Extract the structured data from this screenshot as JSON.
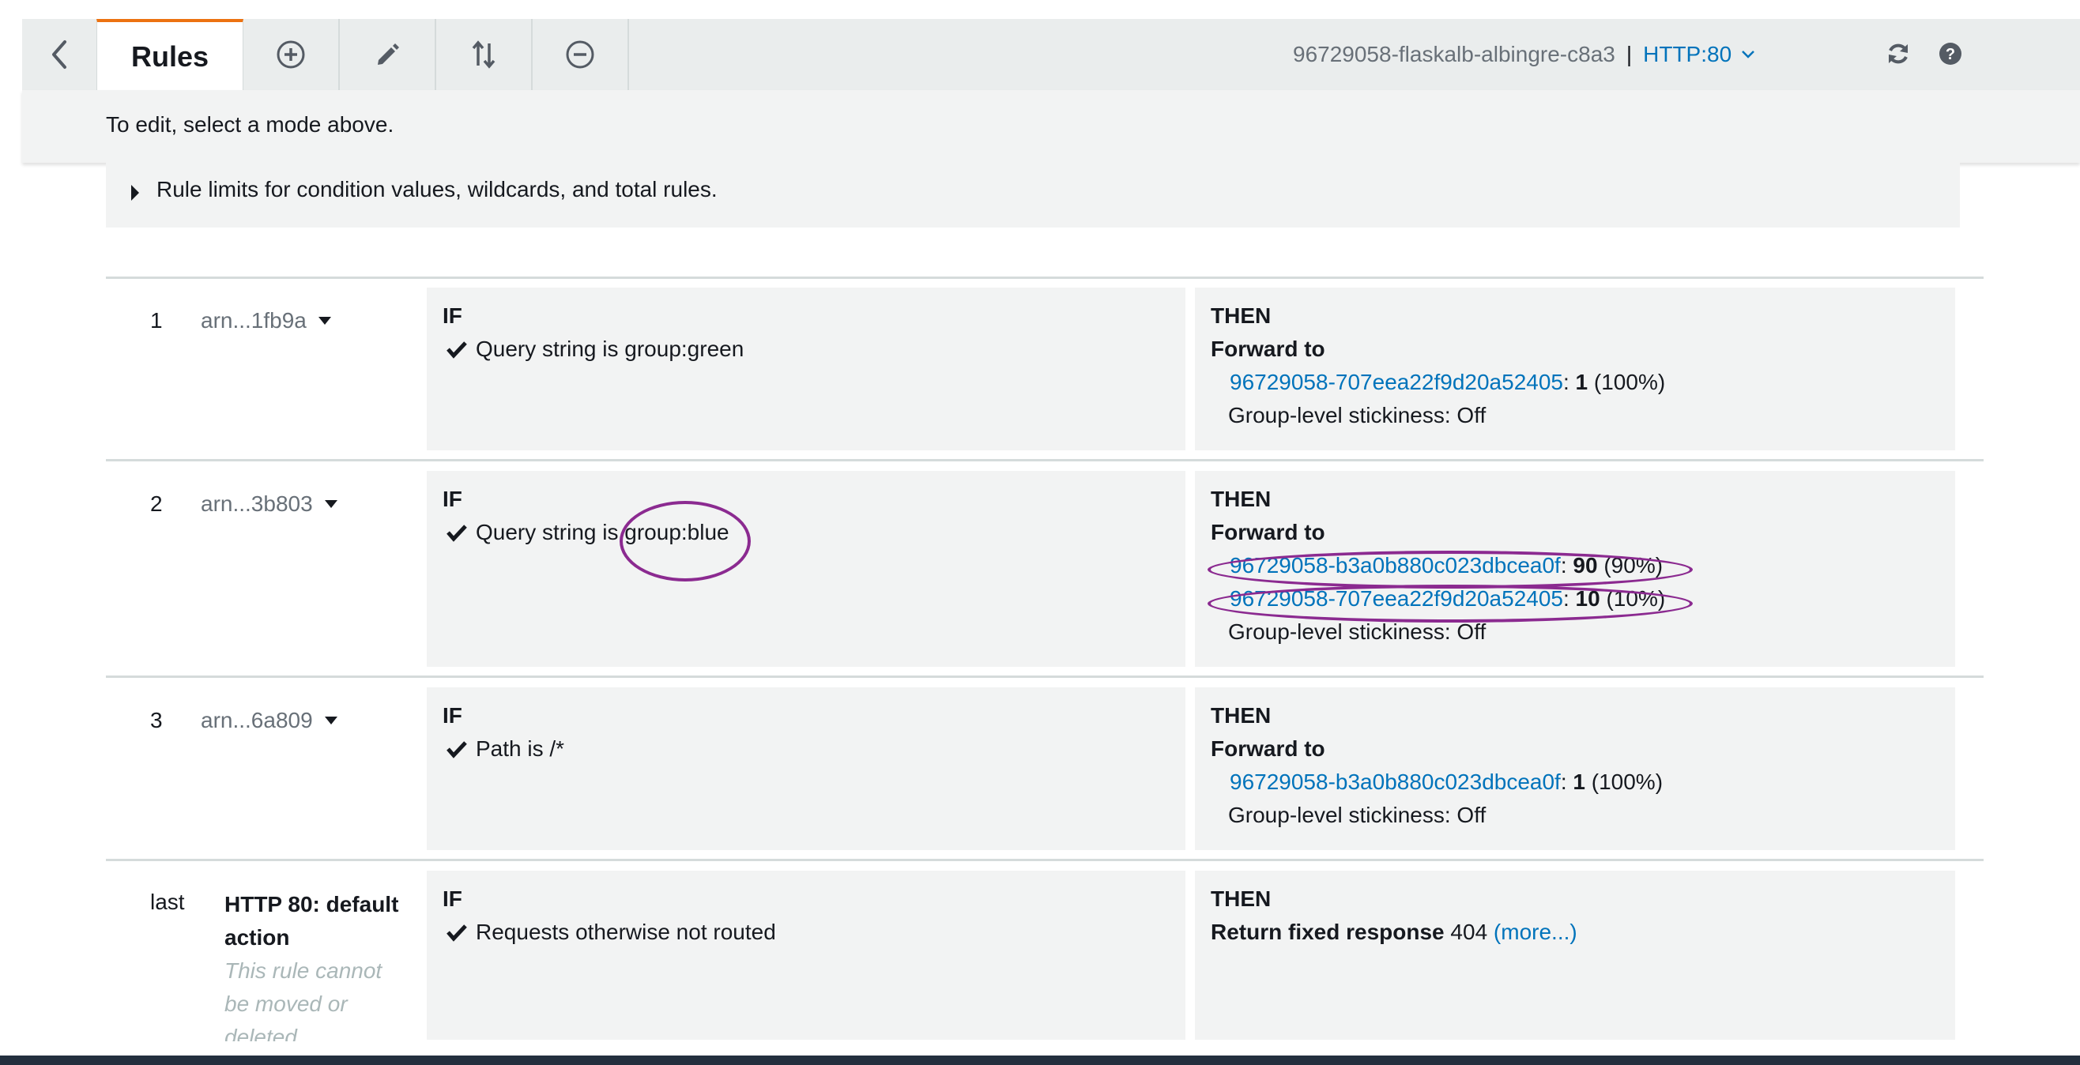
{
  "toolbar": {
    "rules_tab_label": "Rules",
    "load_balancer_name": "96729058-flaskalb-albingre-c8a3",
    "separator": "|",
    "listener": "HTTP:80"
  },
  "notice": "To edit, select a mode above.",
  "limits_text": "Rule limits for condition values, wildcards, and total rules.",
  "labels": {
    "if": "IF",
    "then": "THEN",
    "forward_to": "Forward to",
    "stickiness": "Group-level stickiness: Off"
  },
  "rules": [
    {
      "number": "1",
      "arn": "arn...1fb9a",
      "condition": "Query string is group:green",
      "targets": [
        {
          "name": "96729058-707eea22f9d20a52405",
          "weight": "1",
          "percent": "(100%)"
        }
      ]
    },
    {
      "number": "2",
      "arn": "arn...3b803",
      "condition": "Query string is group:blue",
      "targets": [
        {
          "name": "96729058-b3a0b880c023dbcea0f",
          "weight": "90",
          "percent": "(90%)"
        },
        {
          "name": "96729058-707eea22f9d20a52405",
          "weight": "10",
          "percent": "(10%)"
        }
      ]
    },
    {
      "number": "3",
      "arn": "arn...6a809",
      "condition": "Path is /*",
      "targets": [
        {
          "name": "96729058-b3a0b880c023dbcea0f",
          "weight": "1",
          "percent": "(100%)"
        }
      ]
    }
  ],
  "default_rule": {
    "label": "last",
    "title": "HTTP 80: default action",
    "note": "This rule cannot be moved or deleted",
    "condition": "Requests otherwise not routed",
    "action_label": "Return fixed response",
    "status_code": "404",
    "more_link": "(more...)"
  },
  "colors": {
    "accent": "#ec7211",
    "link": "#0073bb",
    "annotation": "#8b2a90"
  }
}
